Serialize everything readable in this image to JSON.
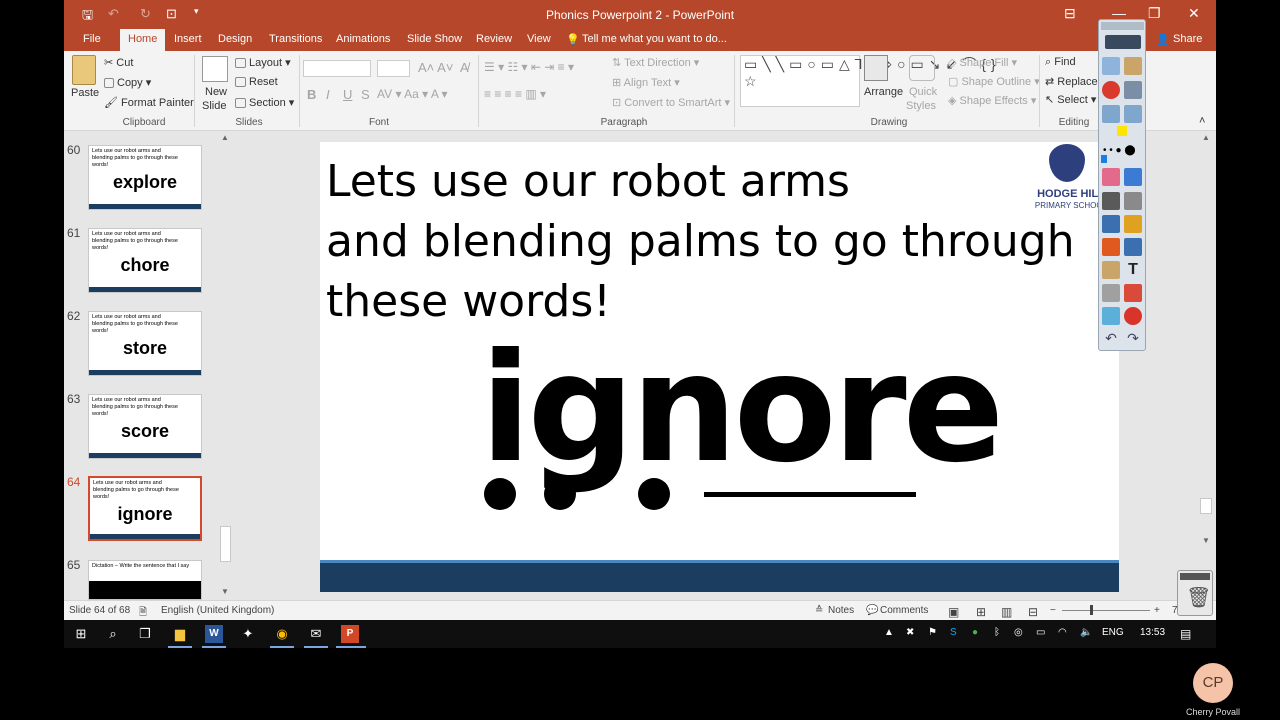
{
  "app": {
    "title": "Phonics Powerpoint 2 - PowerPoint"
  },
  "menu": {
    "file": "File",
    "home": "Home",
    "insert": "Insert",
    "design": "Design",
    "transitions": "Transitions",
    "animations": "Animations",
    "slide_show": "Slide Show",
    "review": "Review",
    "view": "View",
    "tell_me": "Tell me what you want to do...",
    "share": "Share"
  },
  "ribbon": {
    "paste": "Paste",
    "cut": "Cut",
    "copy": "Copy",
    "format_painter": "Format Painter",
    "clipboard": "Clipboard",
    "new_slide": "New",
    "new_slide2": "Slide",
    "layout": "Layout",
    "reset": "Reset",
    "section": "Section",
    "slides": "Slides",
    "font": "Font",
    "bold": "B",
    "italic": "I",
    "underline": "U",
    "strike": "S",
    "text_direction": "Text Direction",
    "align_text": "Align Text",
    "convert_smartart": "Convert to SmartArt",
    "paragraph": "Paragraph",
    "arrange": "Arrange",
    "quick_styles": "Quick",
    "quick_styles2": "Styles",
    "shape_fill": "Shape Fill",
    "shape_outline": "Shape Outline",
    "shape_effects": "Shape Effects",
    "drawing": "Drawing",
    "find": "Find",
    "replace": "Replace",
    "select": "Select",
    "editing": "Editing"
  },
  "thumbnails": [
    {
      "num": "60",
      "text": "Lets use our robot arms and blending palms to go through these words!",
      "word": "explore"
    },
    {
      "num": "61",
      "text": "Lets use our robot arms and blending palms to go through these words!",
      "word": "chore"
    },
    {
      "num": "62",
      "text": "Lets use our robot arms and blending palms to go through these words!",
      "word": "store"
    },
    {
      "num": "63",
      "text": "Lets use our robot arms and blending palms to go through these words!",
      "word": "score"
    },
    {
      "num": "64",
      "text": "Lets use our robot arms and blending palms to go through these words!",
      "word": "ignore"
    },
    {
      "num": "65",
      "text": "Dictation – Write the sentence that I say",
      "word": ""
    }
  ],
  "slide": {
    "line1": "Lets use our robot arms",
    "line2": "and blending palms to go through",
    "line3": "these words!",
    "word": "ignore",
    "logo_name": "HODGE HILL",
    "logo_sub": "PRIMARY SCHOOL"
  },
  "status": {
    "slide_count": "Slide 64 of 68",
    "language": "English (United Kingdom)",
    "notes": "Notes",
    "comments": "Comments",
    "zoom": "7"
  },
  "taskbar": {
    "lang": "ENG",
    "time": "13:53"
  },
  "user": {
    "initials": "CP",
    "name": "Cherry Povall"
  },
  "colors": {
    "accent": "#b7472a",
    "band": "#1b3d5f",
    "selected": "#d04a2d"
  }
}
